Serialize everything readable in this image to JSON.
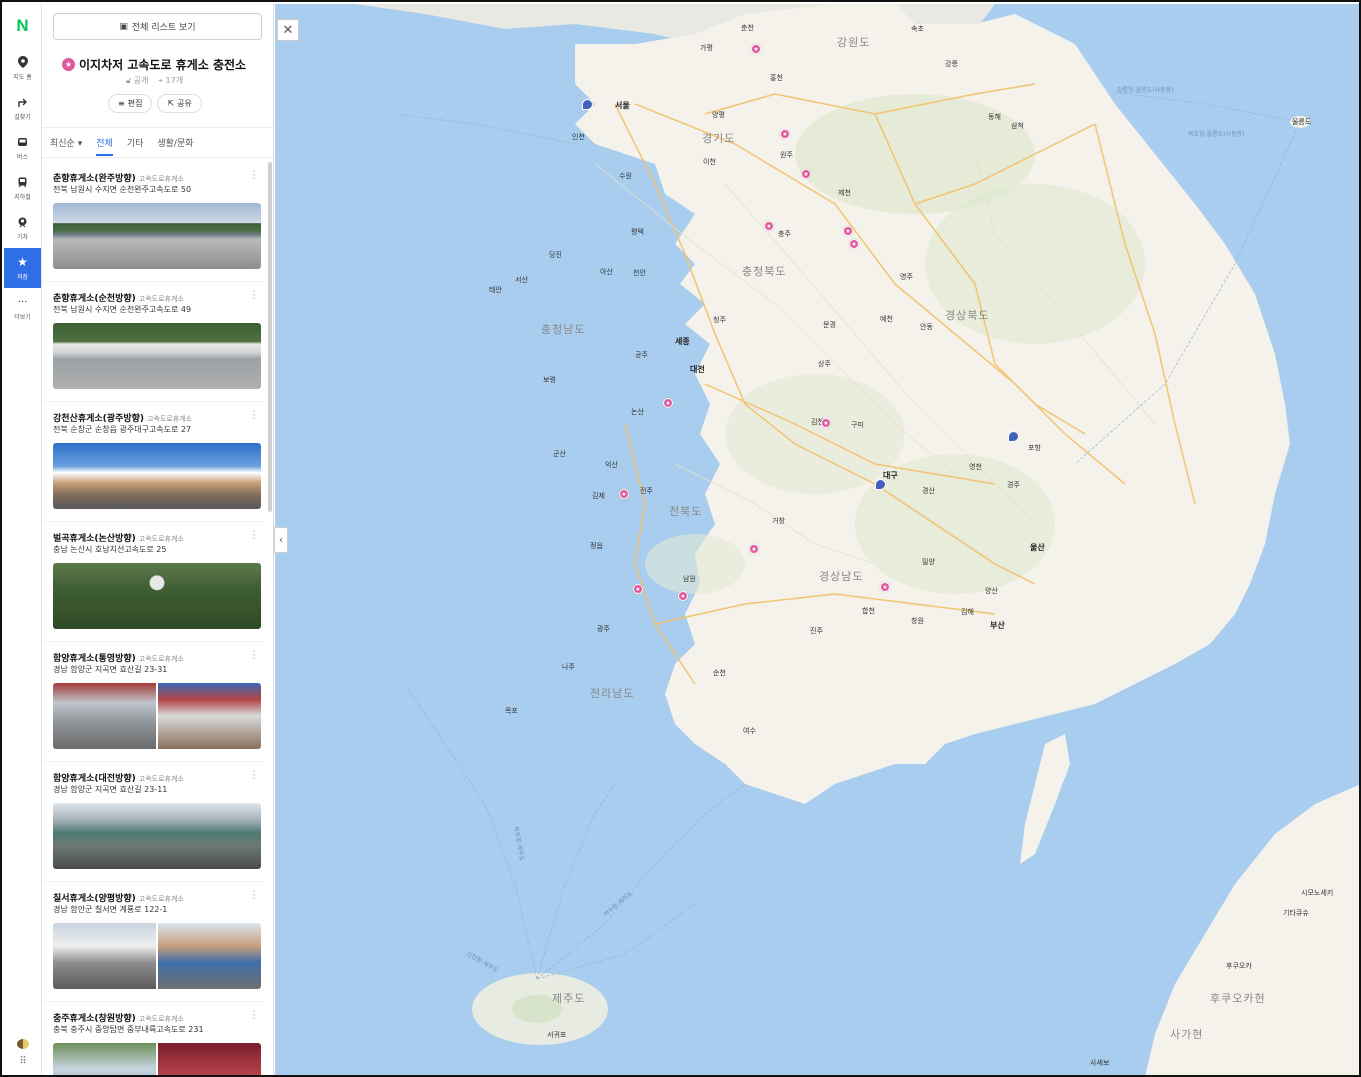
{
  "rail": {
    "logo": "N",
    "items": [
      {
        "label": "지도 홈",
        "icon": "location-pin-icon"
      },
      {
        "label": "길찾기",
        "icon": "directions-arrow-icon"
      },
      {
        "label": "버스",
        "icon": "bus-icon"
      },
      {
        "label": "지하철",
        "icon": "subway-icon"
      },
      {
        "label": "기차",
        "icon": "train-icon"
      },
      {
        "label": "저장",
        "icon": "star-icon"
      },
      {
        "label": "더보기",
        "icon": "more-dots-icon"
      }
    ]
  },
  "panel": {
    "list_all_label": "전체 리스트 보기",
    "title": "이지차저 고속도로 휴게소 충전소",
    "visibility": "공개",
    "count": "17개",
    "edit_label": "편집",
    "share_label": "공유",
    "sort_label": "최신순",
    "filters": [
      "전체",
      "기타",
      "생활/문화"
    ],
    "entries": [
      {
        "name": "춘향휴게소(완주방향)",
        "category": "고속도로휴게소",
        "address": "전북 남원시 수지면 순천완주고속도로 50"
      },
      {
        "name": "춘향휴게소(순천방향)",
        "category": "고속도로휴게소",
        "address": "전북 남원시 수지면 순천완주고속도로 49"
      },
      {
        "name": "강천산휴게소(광주방향)",
        "category": "고속도로휴게소",
        "address": "전북 순창군 순창읍 광주대구고속도로 27"
      },
      {
        "name": "벌곡휴게소(논산방향)",
        "category": "고속도로휴게소",
        "address": "충남 논산시 호남지선고속도로 25"
      },
      {
        "name": "함양휴게소(통영방향)",
        "category": "고속도로휴게소",
        "address": "경남 함양군 지곡면 효산길 23-31"
      },
      {
        "name": "함양휴게소(대전방향)",
        "category": "고속도로휴게소",
        "address": "경남 함양군 지곡면 효산길 23-11"
      },
      {
        "name": "칠서휴게소(양평방향)",
        "category": "고속도로휴게소",
        "address": "경남 함안군 칠서면 계룡로 122-1"
      },
      {
        "name": "충주휴게소(창원방향)",
        "category": "고속도로휴게소",
        "address": "충북 충주시 중앙탑면 중부내륙고속도로 231"
      }
    ]
  },
  "map": {
    "regions": [
      "강원도",
      "경기도",
      "충청북도",
      "충청남도",
      "경상북도",
      "전북도",
      "경상남도",
      "전라남도",
      "제주도",
      "후쿠오카현",
      "사가현"
    ],
    "cities": [
      "서울",
      "세종",
      "대전",
      "대구",
      "울산",
      "부산",
      "광주",
      "포항",
      "전주",
      "청주",
      "춘천",
      "원주",
      "강릉",
      "제천",
      "충주",
      "안동",
      "구미",
      "김천",
      "남원",
      "진주",
      "창원",
      "김해",
      "목포",
      "여수",
      "순천",
      "인천",
      "수원",
      "천안",
      "공주",
      "논산",
      "익산",
      "군산",
      "김제",
      "정읍",
      "나주",
      "거창",
      "합천",
      "밀양",
      "양산",
      "경주",
      "영천",
      "경산",
      "상주",
      "문경",
      "예천",
      "영주",
      "동해",
      "삼척",
      "속초",
      "가평",
      "홍천",
      "양평",
      "이천",
      "평택",
      "아산",
      "당진",
      "서산",
      "태안",
      "보령",
      "서귀포",
      "울릉도",
      "후쿠오카",
      "기타큐슈",
      "시모노세키",
      "사세보"
    ],
    "sea_labels": [
      "인천항-제주도",
      "목포항-제주도",
      "여수항-제주도",
      "강릉항-울릉도(사동항)",
      "묵호항-울릉도(사동항)"
    ],
    "accent": "#e0579d",
    "sea_color": "#a9cdee",
    "land_color": "#f4f2ea"
  }
}
